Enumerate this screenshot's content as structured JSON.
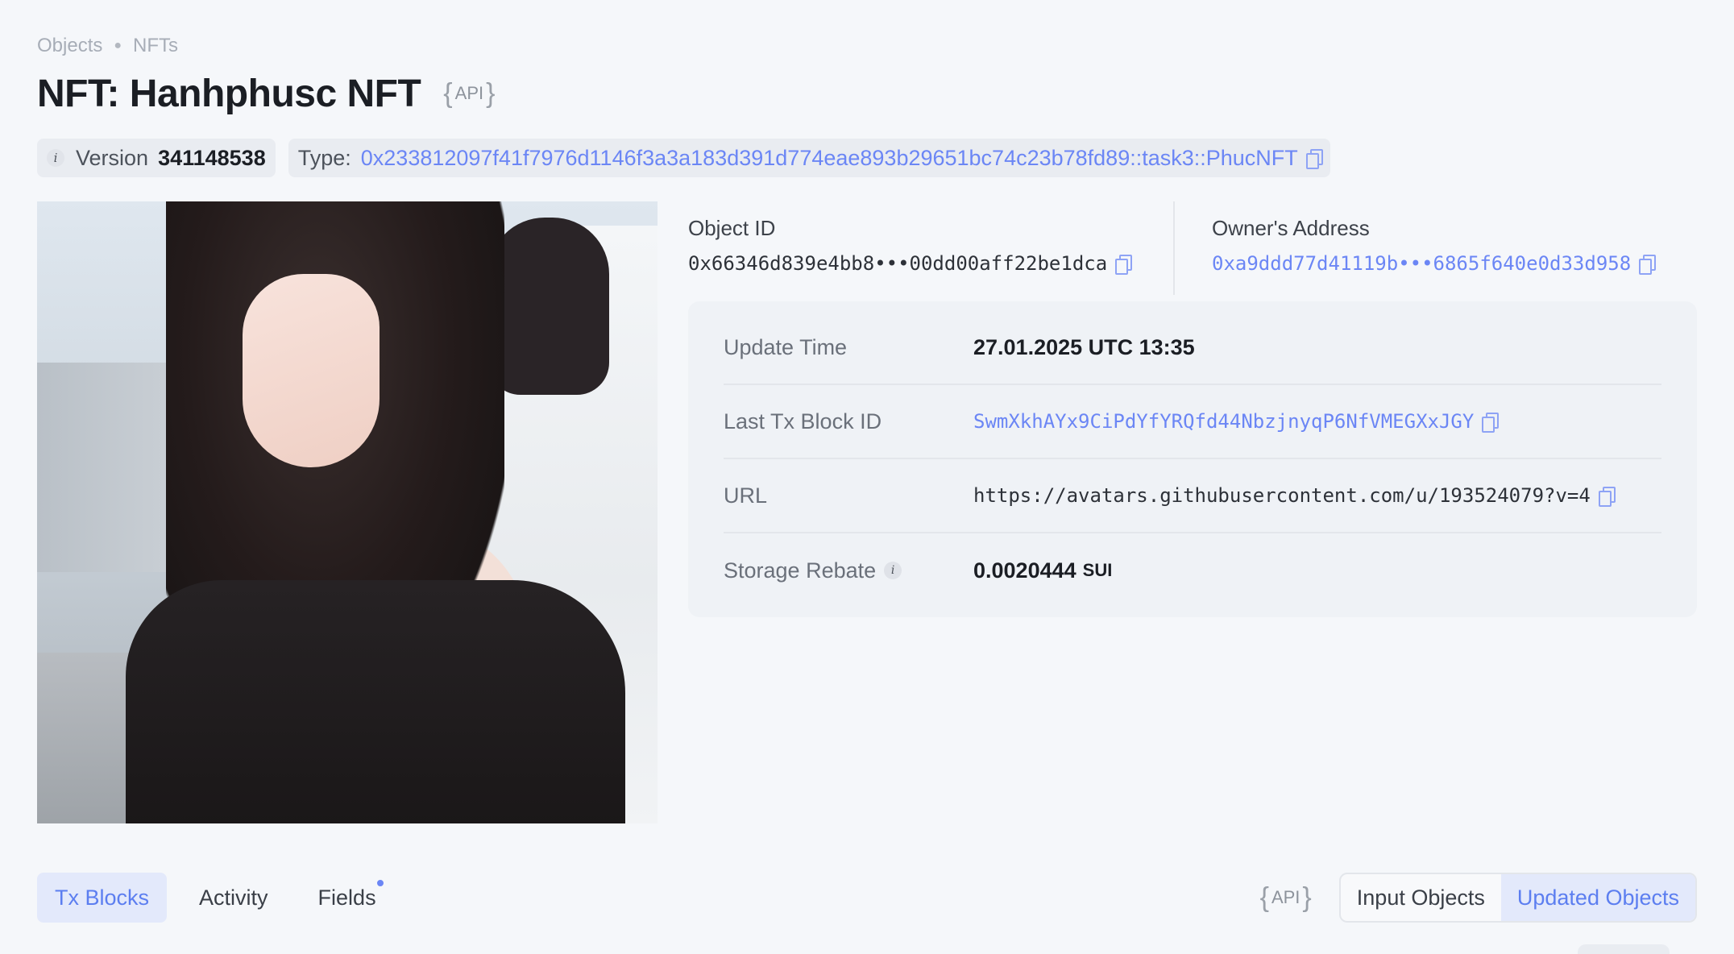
{
  "breadcrumb": {
    "items": [
      "Objects",
      "NFTs"
    ]
  },
  "title": "NFT: Hanhphusc NFT",
  "api_label": "API",
  "version": {
    "label": "Version",
    "value": "341148538"
  },
  "type": {
    "label": "Type:",
    "value": "0x233812097f41f7976d1146f3a3a183d391d774eae893b29651bc74c23b78fd89::task3::PhucNFT"
  },
  "object_id": {
    "label": "Object ID",
    "value": "0x66346d839e4bb8•••00dd00aff22be1dca"
  },
  "owner": {
    "label": "Owner's Address",
    "value": "0xa9ddd77d41119b•••6865f640e0d33d958"
  },
  "details": {
    "update_time": {
      "label": "Update Time",
      "value": "27.01.2025 UTC 13:35"
    },
    "last_tx": {
      "label": "Last Tx Block ID",
      "value": "SwmXkhAYx9CiPdYfYRQfd44NbzjnyqP6NfVMEGXxJGY"
    },
    "url": {
      "label": "URL",
      "value": "https://avatars.githubusercontent.com/u/193524079?v=4"
    },
    "storage_rebate": {
      "label": "Storage Rebate",
      "value": "0.0020444",
      "unit": "SUI"
    }
  },
  "tabs": [
    "Tx Blocks",
    "Activity",
    "Fields"
  ],
  "segments": [
    "Input Objects",
    "Updated Objects"
  ],
  "colors": {
    "accent": "#6b86f5",
    "active_bg": "#e3e9fb",
    "page_bg": "#f5f7fa"
  },
  "icons": {
    "info": "info-icon",
    "copy": "copy-icon"
  }
}
